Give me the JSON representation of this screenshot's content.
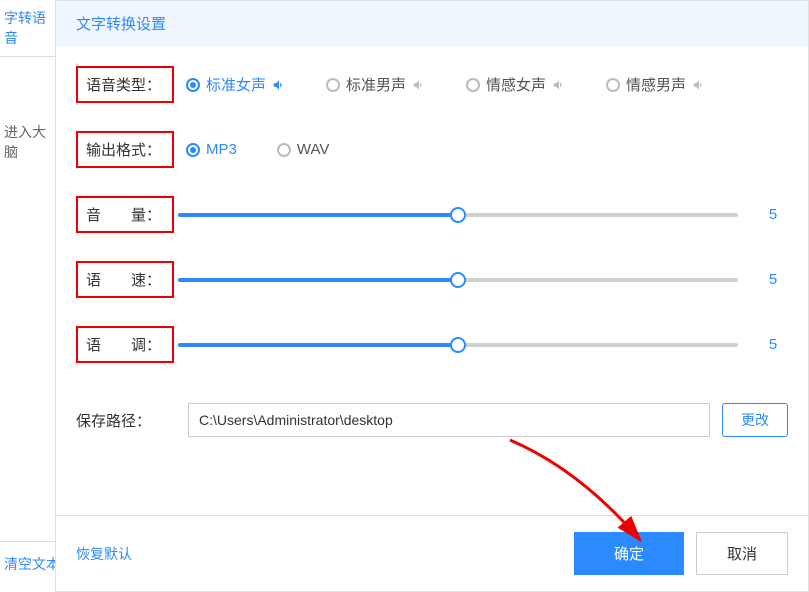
{
  "background": {
    "tab": "字转语音",
    "text_hint": "进入大脑",
    "clear_btn": "清空文本"
  },
  "panel": {
    "title": "文字转换设置"
  },
  "voice_type": {
    "label": "语音类型：",
    "options": [
      "标准女声",
      "标准男声",
      "情感女声",
      "情感男声"
    ],
    "selected": 0
  },
  "output_format": {
    "label": "输出格式：",
    "options": [
      "MP3",
      "WAV"
    ],
    "selected": 0
  },
  "volume": {
    "label": "音　　量：",
    "value": "5"
  },
  "speed": {
    "label": "语　　速：",
    "value": "5"
  },
  "pitch": {
    "label": "语　　调：",
    "value": "5"
  },
  "save_path": {
    "label": "保存路径：",
    "value": "C:\\Users\\Administrator\\desktop",
    "change_btn": "更改"
  },
  "footer": {
    "reset": "恢复默认",
    "confirm": "确定",
    "cancel": "取消"
  }
}
